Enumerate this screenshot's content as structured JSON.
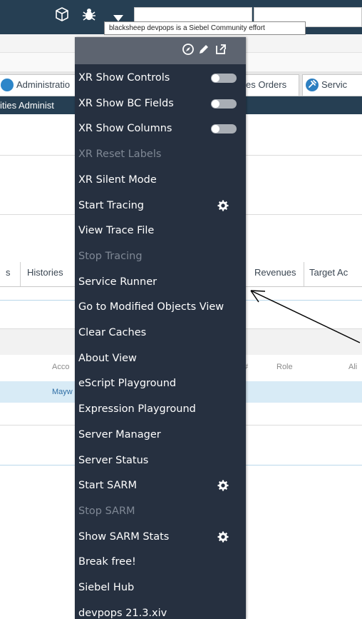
{
  "header": {
    "icons": [
      "cube-icon",
      "bug-icon",
      "caret-down-icon"
    ],
    "tooltip": "blacksheep devpops is a Siebel Community effort"
  },
  "screen_tabs": [
    {
      "label": "Administratio",
      "icon": "circle-icon"
    },
    {
      "label": "es Orders"
    },
    {
      "label": "Servic",
      "icon": "tools-icon"
    }
  ],
  "view_bar": {
    "text": "ities Administ"
  },
  "view_tabs": [
    "s",
    "Histories",
    "Revenues",
    "Target Ac"
  ],
  "list": {
    "columns": [
      "Acco",
      "#",
      "Role",
      "Ali"
    ],
    "selected_row": {
      "account": "Mayw"
    }
  },
  "menu": {
    "top_icons": [
      "compass-icon",
      "pencil-icon",
      "external-link-icon"
    ],
    "items": [
      {
        "label": "XR Show Controls",
        "state": "enabled",
        "control": "toggle",
        "toggle_on": false
      },
      {
        "label": "XR Show BC Fields",
        "state": "enabled",
        "control": "toggle",
        "toggle_on": false
      },
      {
        "label": "XR Show Columns",
        "state": "enabled",
        "control": "toggle",
        "toggle_on": false
      },
      {
        "label": "XR Reset Labels",
        "state": "disabled"
      },
      {
        "label": "XR Silent Mode",
        "state": "enabled"
      },
      {
        "label": "Start Tracing",
        "state": "enabled",
        "control": "gear"
      },
      {
        "label": "View Trace File",
        "state": "enabled"
      },
      {
        "label": "Stop Tracing",
        "state": "disabled"
      },
      {
        "label": "Service Runner",
        "state": "enabled"
      },
      {
        "label": "Go to Modified Objects View",
        "state": "enabled"
      },
      {
        "label": "Clear Caches",
        "state": "enabled"
      },
      {
        "label": "About View",
        "state": "enabled"
      },
      {
        "label": "eScript Playground",
        "state": "enabled"
      },
      {
        "label": "Expression Playground",
        "state": "enabled"
      },
      {
        "label": "Server Manager",
        "state": "enabled"
      },
      {
        "label": "Server Status",
        "state": "enabled"
      },
      {
        "label": "Start SARM",
        "state": "enabled",
        "control": "gear"
      },
      {
        "label": "Stop SARM",
        "state": "disabled"
      },
      {
        "label": "Show SARM Stats",
        "state": "enabled",
        "control": "gear"
      },
      {
        "label": "Break free!",
        "state": "enabled"
      },
      {
        "label": "Siebel Hub",
        "state": "enabled"
      },
      {
        "label": "devpops 21.3.xiv",
        "state": "enabled"
      }
    ]
  },
  "colors": {
    "header_bg": "#263f53",
    "menu_bg": "#263040",
    "menu_header_bg": "#5d6470",
    "menu_text": "#ffffff",
    "menu_disabled_text": "#7f8895",
    "selected_row": "#d8ebf6"
  }
}
